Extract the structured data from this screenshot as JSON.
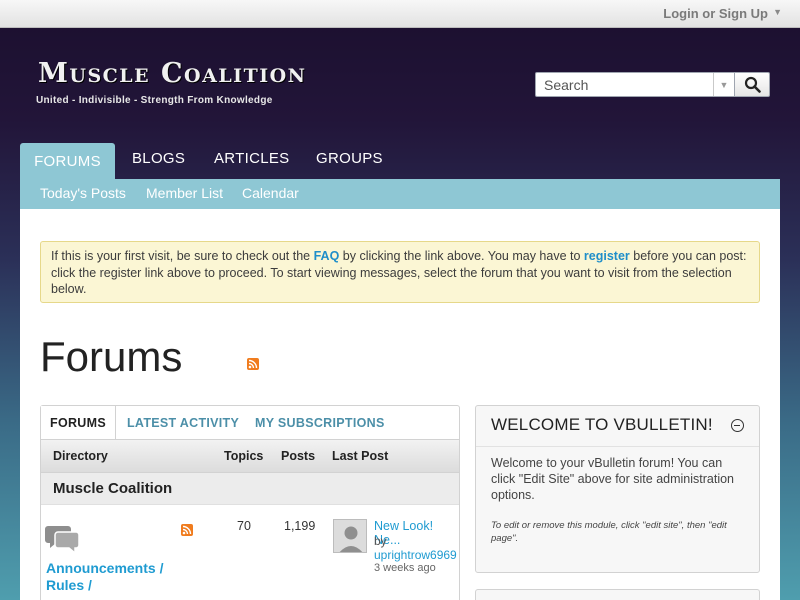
{
  "topbar": {
    "login_label": "Login or Sign Up"
  },
  "logo": {
    "title": "Muscle Coalition",
    "tagline": "United - Indivisible - Strength From Knowledge"
  },
  "search": {
    "placeholder": "Search"
  },
  "nav": {
    "tabs": [
      "FORUMS",
      "BLOGS",
      "ARTICLES",
      "GROUPS"
    ],
    "active": "FORUMS"
  },
  "subnav": {
    "items": [
      "Today's Posts",
      "Member List",
      "Calendar"
    ]
  },
  "notice": {
    "part1": "If this is your first visit, be sure to check out the ",
    "faq_link": "FAQ",
    "part2": " by clicking the link above. You may have to ",
    "register_link": "register",
    "part3": " before you can post: click the register link above to proceed. To start viewing messages, select the forum that you want to visit from the selection below."
  },
  "page": {
    "title": "Forums"
  },
  "forum_panel": {
    "tabs": [
      "FORUMS",
      "LATEST ACTIVITY",
      "MY SUBSCRIPTIONS"
    ],
    "columns": {
      "directory": "Directory",
      "topics": "Topics",
      "posts": "Posts",
      "last_post": "Last Post"
    },
    "section_title": "Muscle Coalition",
    "rows": [
      {
        "name": "Announcements / Rules /",
        "topics": "70",
        "posts": "1,199",
        "last_post_title": "New Look! Ne...",
        "last_post_by": "by",
        "last_post_user": "uprightrow6969",
        "last_post_time": "3 weeks ago"
      }
    ]
  },
  "welcome": {
    "title": "WELCOME TO VBULLETIN!",
    "body": "Welcome to your vBulletin forum! You can click \"Edit Site\" above for site administration options.",
    "note": "To edit or remove this module, click \"edit site\", then \"edit page\"."
  },
  "colors": {
    "accent": "#8ec7d4",
    "link": "#1f9bd1",
    "rss": "#f07c1e"
  }
}
